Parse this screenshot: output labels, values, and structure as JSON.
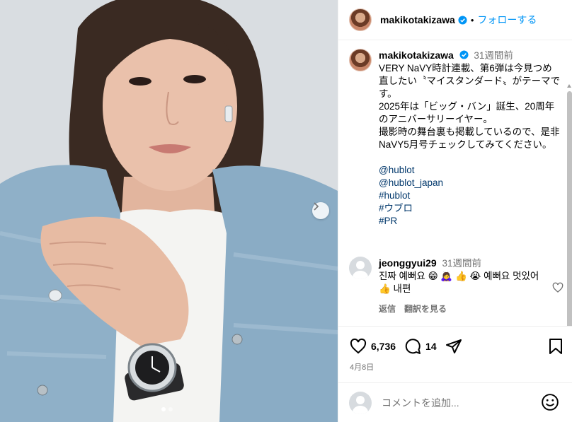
{
  "post": {
    "username": "makikotakizawa",
    "follow_label": "フォローする",
    "separator": "•",
    "media_icons": {
      "next": "chevron-right-icon",
      "dots": 2,
      "active_dot": 0
    }
  },
  "caption": {
    "username": "makikotakizawa",
    "time": "31週間前",
    "text": "VERY NaVY時計連載、第6弾は今見つめ直したい〝マイスタンダード〟がテーマです。\n2025年は「ビッグ・バン」誕生、20周年のアニバーサリーイヤー。\n撮影時の舞台裏も掲載しているので、是非NaVY5月号チェックしてみてください。",
    "tags": [
      "@hublot",
      "@hublot_japan",
      "#hublot",
      "#ウブロ",
      "#PR"
    ]
  },
  "comment": {
    "username": "jeonggyui29",
    "time": "31週間前",
    "text": "진짜 예뻐요 😁 🙇‍♀️ 👍 😭 예뻐요 멋있어 👍 내편",
    "reply_label": "返信",
    "translate_label": "翻訳を見る"
  },
  "actions": {
    "likes": "6,736",
    "comments": "14",
    "date": "4月8日"
  },
  "add_comment": {
    "placeholder": "コメントを追加..."
  },
  "colors": {
    "accent": "#0095f6",
    "link": "#00376b",
    "muted": "#737373",
    "verified": "#0095f6"
  }
}
